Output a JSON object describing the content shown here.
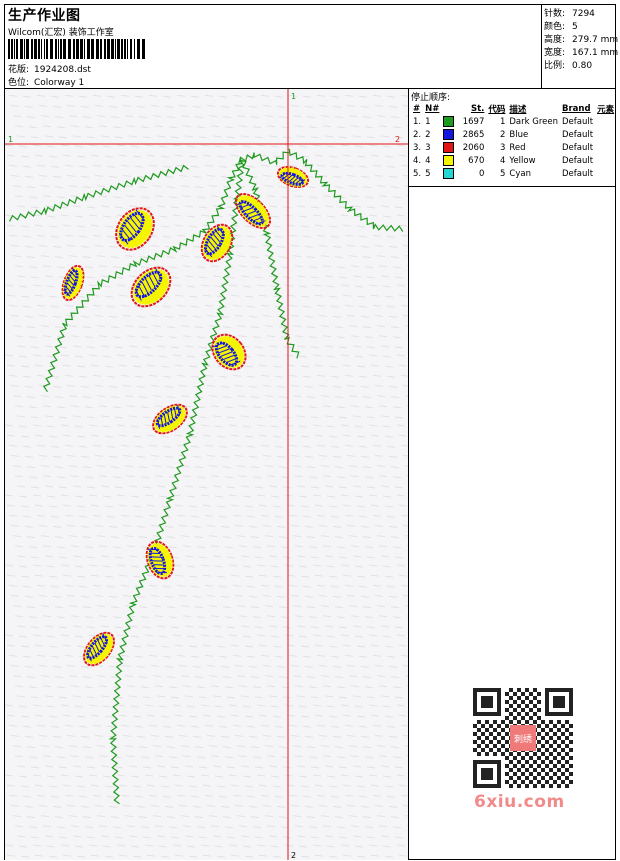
{
  "header": {
    "title": "生产作业图",
    "company": "Wilcom(汇宏) 装饰工作室",
    "design_label": "花版:",
    "design_value": "1924208.dst",
    "colorway_label": "色位:",
    "colorway_value": "Colorway 1"
  },
  "stats": {
    "stitches_label": "针数:",
    "stitches_value": "7294",
    "colors_label": "颜色:",
    "colors_value": "5",
    "height_label": "高度:",
    "height_value": "279.7 mm",
    "width_label": "宽度:",
    "width_value": "167.1 mm",
    "scale_label": "比例:",
    "scale_value": "0.80"
  },
  "guides": {
    "v_top": "1",
    "v_bottom": "2",
    "h_left": "1",
    "h_right": "2"
  },
  "color_table": {
    "title": "停止顺序:",
    "headers": [
      "#",
      "N#",
      "St.",
      "代码",
      "描述",
      "Brand",
      "元素"
    ],
    "rows": [
      {
        "idx": "1.",
        "n": "1",
        "color": "#1e9a1e",
        "st": "1697",
        "code": "1",
        "desc": "Dark Green",
        "brand": "Default"
      },
      {
        "idx": "2.",
        "n": "2",
        "color": "#1515e0",
        "st": "2865",
        "code": "2",
        "desc": "Blue",
        "brand": "Default"
      },
      {
        "idx": "3.",
        "n": "3",
        "color": "#e01515",
        "st": "2060",
        "code": "3",
        "desc": "Red",
        "brand": "Default"
      },
      {
        "idx": "4.",
        "n": "4",
        "color": "#f5f500",
        "st": "670",
        "code": "4",
        "desc": "Yellow",
        "brand": "Default"
      },
      {
        "idx": "5.",
        "n": "5",
        "color": "#22d6d6",
        "st": "0",
        "code": "5",
        "desc": "Cyan",
        "brand": "Default"
      }
    ]
  },
  "thread_colors": {
    "green": "#1e9a1e",
    "blue": "#1515e0",
    "red": "#e01515",
    "yellow": "#f5f500"
  },
  "watermark": {
    "text": "6xiu.com",
    "qr_badge": "刺绣"
  }
}
